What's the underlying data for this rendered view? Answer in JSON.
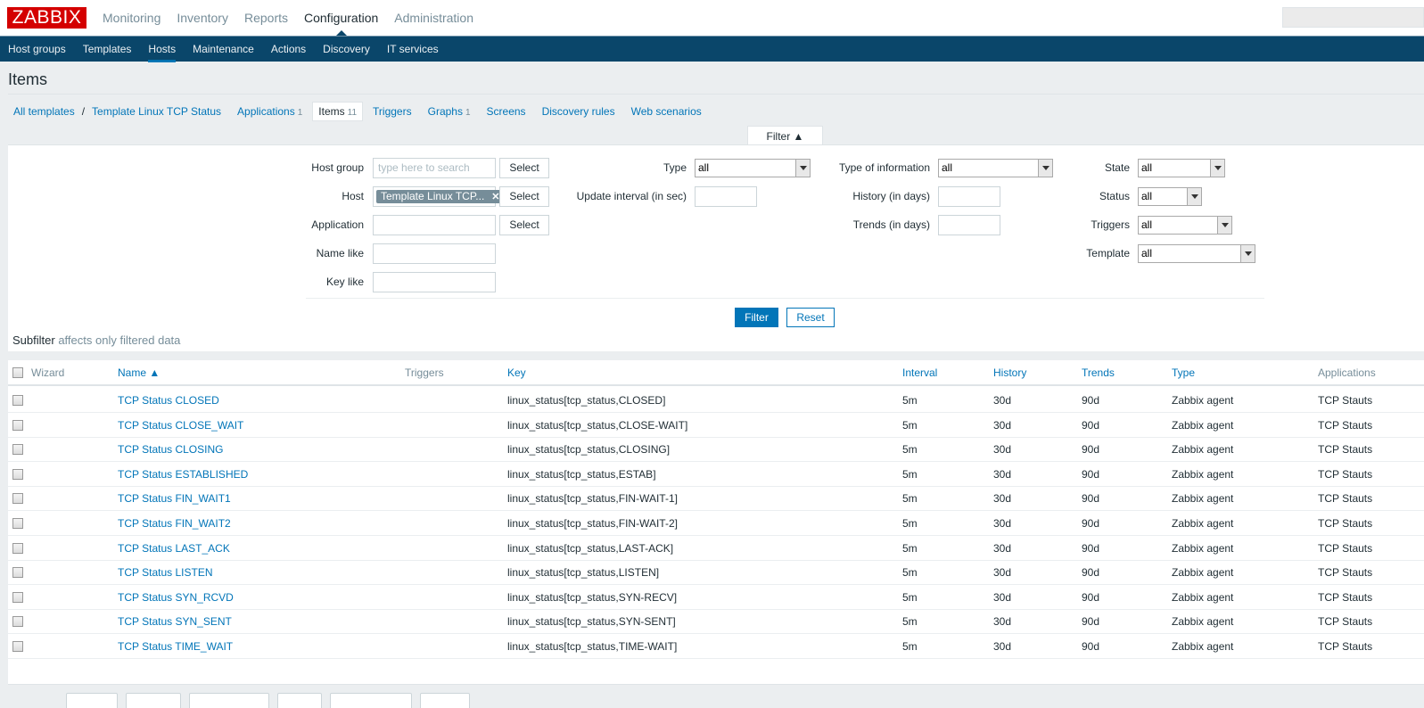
{
  "header": {
    "logo": "ZABBIX",
    "menu": [
      "Monitoring",
      "Inventory",
      "Reports",
      "Configuration",
      "Administration"
    ],
    "active_menu": "Configuration"
  },
  "submenu": {
    "items": [
      "Host groups",
      "Templates",
      "Hosts",
      "Maintenance",
      "Actions",
      "Discovery",
      "IT services"
    ],
    "active": "Hosts"
  },
  "page": {
    "title": "Items"
  },
  "breadcrumbs": {
    "all_templates": "All templates",
    "separator": "/",
    "template": "Template Linux TCP Status",
    "tabs": [
      {
        "label": "Applications",
        "count": "1"
      },
      {
        "label": "Items",
        "count": "11",
        "active": true
      },
      {
        "label": "Triggers",
        "count": ""
      },
      {
        "label": "Graphs",
        "count": "1"
      },
      {
        "label": "Screens",
        "count": ""
      },
      {
        "label": "Discovery rules",
        "count": ""
      },
      {
        "label": "Web scenarios",
        "count": ""
      }
    ]
  },
  "filter": {
    "tab_label": "Filter ▲",
    "host_group_label": "Host group",
    "host_group_placeholder": "type here to search",
    "host_label": "Host",
    "host_tag": "Template Linux TCP...",
    "host_tag_remove": "✕",
    "application_label": "Application",
    "name_like_label": "Name like",
    "key_like_label": "Key like",
    "select_label": "Select",
    "type_label": "Type",
    "type_value": "all",
    "update_interval_label": "Update interval (in sec)",
    "type_of_info_label": "Type of information",
    "type_of_info_value": "all",
    "history_label": "History (in days)",
    "trends_label": "Trends (in days)",
    "state_label": "State",
    "state_value": "all",
    "status_label": "Status",
    "status_value": "all",
    "triggers_label": "Triggers",
    "triggers_value": "all",
    "template_label": "Template",
    "template_value": "all",
    "filter_button": "Filter",
    "reset_button": "Reset"
  },
  "subfilter": {
    "title": "Subfilter",
    "note": "affects only filtered data"
  },
  "table": {
    "headers": {
      "wizard": "Wizard",
      "name": "Name ▲",
      "triggers": "Triggers",
      "key": "Key",
      "interval": "Interval",
      "history": "History",
      "trends": "Trends",
      "type": "Type",
      "applications": "Applications"
    },
    "rows": [
      {
        "name": "TCP Status CLOSED",
        "key": "linux_status[tcp_status,CLOSED]",
        "interval": "5m",
        "history": "30d",
        "trends": "90d",
        "type": "Zabbix agent",
        "applications": "TCP Stauts"
      },
      {
        "name": "TCP Status CLOSE_WAIT",
        "key": "linux_status[tcp_status,CLOSE-WAIT]",
        "interval": "5m",
        "history": "30d",
        "trends": "90d",
        "type": "Zabbix agent",
        "applications": "TCP Stauts"
      },
      {
        "name": "TCP Status CLOSING",
        "key": "linux_status[tcp_status,CLOSING]",
        "interval": "5m",
        "history": "30d",
        "trends": "90d",
        "type": "Zabbix agent",
        "applications": "TCP Stauts"
      },
      {
        "name": "TCP Status ESTABLISHED",
        "key": "linux_status[tcp_status,ESTAB]",
        "interval": "5m",
        "history": "30d",
        "trends": "90d",
        "type": "Zabbix agent",
        "applications": "TCP Stauts"
      },
      {
        "name": "TCP Status FIN_WAIT1",
        "key": "linux_status[tcp_status,FIN-WAIT-1]",
        "interval": "5m",
        "history": "30d",
        "trends": "90d",
        "type": "Zabbix agent",
        "applications": "TCP Stauts"
      },
      {
        "name": "TCP Status FIN_WAIT2",
        "key": "linux_status[tcp_status,FIN-WAIT-2]",
        "interval": "5m",
        "history": "30d",
        "trends": "90d",
        "type": "Zabbix agent",
        "applications": "TCP Stauts"
      },
      {
        "name": "TCP Status LAST_ACK",
        "key": "linux_status[tcp_status,LAST-ACK]",
        "interval": "5m",
        "history": "30d",
        "trends": "90d",
        "type": "Zabbix agent",
        "applications": "TCP Stauts"
      },
      {
        "name": "TCP Status LISTEN",
        "key": "linux_status[tcp_status,LISTEN]",
        "interval": "5m",
        "history": "30d",
        "trends": "90d",
        "type": "Zabbix agent",
        "applications": "TCP Stauts"
      },
      {
        "name": "TCP Status SYN_RCVD",
        "key": "linux_status[tcp_status,SYN-RECV]",
        "interval": "5m",
        "history": "30d",
        "trends": "90d",
        "type": "Zabbix agent",
        "applications": "TCP Stauts"
      },
      {
        "name": "TCP Status SYN_SENT",
        "key": "linux_status[tcp_status,SYN-SENT]",
        "interval": "5m",
        "history": "30d",
        "trends": "90d",
        "type": "Zabbix agent",
        "applications": "TCP Stauts"
      },
      {
        "name": "TCP Status TIME_WAIT",
        "key": "linux_status[tcp_status,TIME-WAIT]",
        "interval": "5m",
        "history": "30d",
        "trends": "90d",
        "type": "Zabbix agent",
        "applications": "TCP Stauts"
      }
    ]
  }
}
